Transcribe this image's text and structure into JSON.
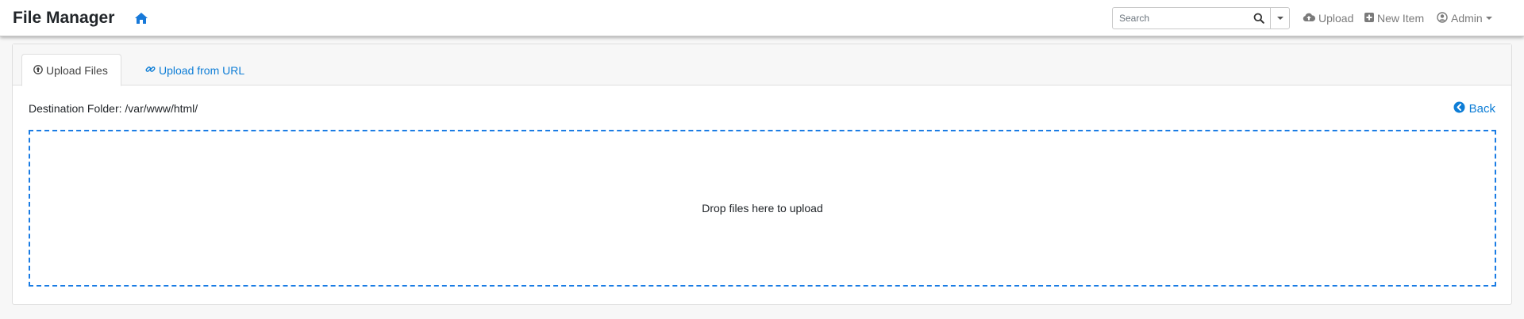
{
  "app": {
    "brand": "File Manager"
  },
  "navbar": {
    "home_icon": "home-icon",
    "search": {
      "placeholder": "Search",
      "value": "",
      "icon": "search-icon"
    },
    "upload_label": "Upload",
    "new_item_label": "New Item",
    "admin_label": "Admin"
  },
  "tabs": [
    {
      "label": "Upload Files",
      "icon": "upload-circle-icon",
      "active": true
    },
    {
      "label": "Upload from URL",
      "icon": "link-icon",
      "active": false
    }
  ],
  "content": {
    "destination_label": "Destination Folder: /var/www/html/",
    "back_label": "Back",
    "dropzone_text": "Drop files here to upload"
  },
  "colors": {
    "accent": "#0d7dd6",
    "dropzone_border": "#1a7ce4",
    "nav_text": "#7a7a7a"
  }
}
